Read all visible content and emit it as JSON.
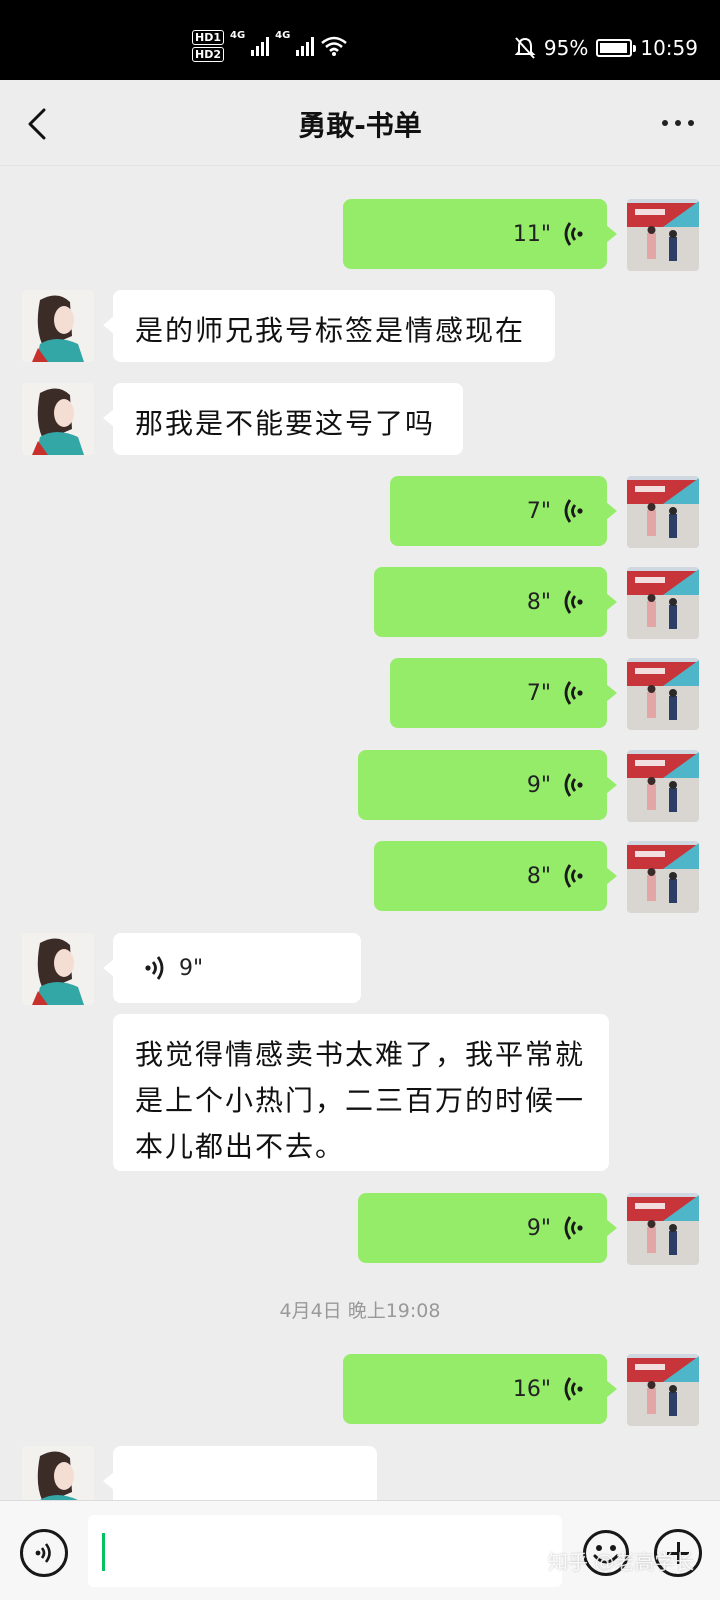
{
  "status_bar": {
    "sim1": "HD1",
    "sim2": "HD2",
    "network1": "4G",
    "network2": "4G",
    "battery": "95%",
    "time": "10:59",
    "icons": [
      "mute-icon",
      "wifi-icon",
      "battery-icon"
    ]
  },
  "header": {
    "title": "勇敢-书单",
    "back_icon": "chevron-left-icon",
    "more_icon": "more-dots-icon"
  },
  "messages": [
    {
      "side": "out",
      "kind": "voice",
      "duration": "11\""
    },
    {
      "side": "in",
      "kind": "text",
      "text": "是的师兄我号标签是情感现在"
    },
    {
      "side": "in",
      "kind": "text",
      "text": "那我是不能要这号了吗"
    },
    {
      "side": "out",
      "kind": "voice",
      "duration": "7\""
    },
    {
      "side": "out",
      "kind": "voice",
      "duration": "8\""
    },
    {
      "side": "out",
      "kind": "voice",
      "duration": "7\""
    },
    {
      "side": "out",
      "kind": "voice",
      "duration": "9\""
    },
    {
      "side": "out",
      "kind": "voice",
      "duration": "8\""
    },
    {
      "side": "in",
      "kind": "voice",
      "duration": "9\""
    },
    {
      "side": "in",
      "kind": "text",
      "text": "我觉得情感卖书太难了，我平常就是上个小热门，二三百万的时候一本儿都出不去。"
    },
    {
      "side": "out",
      "kind": "voice",
      "duration": "9\""
    },
    {
      "side": "out",
      "kind": "voice",
      "duration": "16\""
    }
  ],
  "timestamp": "4月4日 晚上19:08",
  "input_bar": {
    "voice_icon": "voice-mode-icon",
    "emoji_icon": "emoji-icon",
    "plus_icon": "plus-icon",
    "value": ""
  },
  "watermark": "知乎 @老高学长",
  "colors": {
    "outgoing_bubble": "#95ec69",
    "incoming_bubble": "#ffffff",
    "background": "#ededed",
    "caret": "#07c160"
  }
}
